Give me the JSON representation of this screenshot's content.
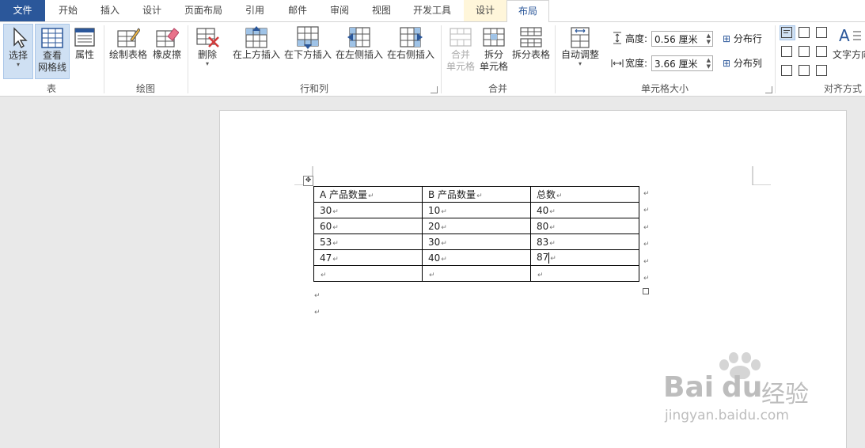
{
  "tabs": [
    {
      "id": "file",
      "label": "文件"
    },
    {
      "id": "home",
      "label": "开始"
    },
    {
      "id": "insert",
      "label": "插入"
    },
    {
      "id": "design",
      "label": "设计"
    },
    {
      "id": "pagelayout",
      "label": "页面布局"
    },
    {
      "id": "references",
      "label": "引用"
    },
    {
      "id": "mailings",
      "label": "邮件"
    },
    {
      "id": "review",
      "label": "审阅"
    },
    {
      "id": "view",
      "label": "视图"
    },
    {
      "id": "developer",
      "label": "开发工具"
    },
    {
      "id": "tabledesign",
      "label": "设计"
    },
    {
      "id": "layout",
      "label": "布局"
    }
  ],
  "ribbon": {
    "groups": {
      "table": "表",
      "draw": "绘图",
      "rowscols": "行和列",
      "merge": "合并",
      "cellsize": "单元格大小",
      "align": "对齐方式"
    },
    "select": "选择",
    "gridlines": [
      "查看",
      "网格线"
    ],
    "properties": "属性",
    "draw_table": "绘制表格",
    "eraser": "橡皮擦",
    "delete": "删除",
    "insert_above": "在上方插入",
    "insert_below": "在下方插入",
    "insert_left": "在左侧插入",
    "insert_right": "在右侧插入",
    "merge_cells": [
      "合并",
      "单元格"
    ],
    "split_cells": [
      "拆分",
      "单元格"
    ],
    "split_table": "拆分表格",
    "autofit": "自动调整",
    "height_label": "高度:",
    "height_value": "0.56 厘米",
    "width_label": "宽度:",
    "width_value": "3.66 厘米",
    "distribute_rows": "分布行",
    "distribute_cols": "分布列",
    "text_direction": "文字方向"
  },
  "table": {
    "headers": [
      "A 产品数量",
      "B 产品数量",
      "总数"
    ],
    "rows": [
      [
        "30",
        "10",
        "40"
      ],
      [
        "60",
        "20",
        "80"
      ],
      [
        "53",
        "30",
        "83"
      ],
      [
        "47",
        "40",
        "87"
      ],
      [
        "",
        "",
        ""
      ]
    ]
  },
  "watermark": {
    "brand": "Bai",
    "brand2": "du",
    "cn": "经验",
    "url": "jingyan.baidu.com"
  },
  "colors": {
    "file_tab": "#2b579a",
    "context_tab": "#fff6da",
    "accent": "#2b579a"
  }
}
